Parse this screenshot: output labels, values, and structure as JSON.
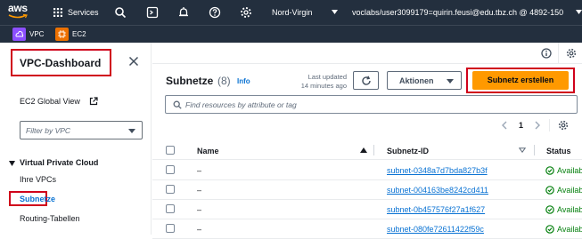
{
  "topbar": {
    "logo_text": "aws",
    "services_label": "Services",
    "region": "Nord-Virgin",
    "account": "voclabs/user3099179=quirin.feusi@edu.tbz.ch @ 4892-150"
  },
  "favorites": [
    {
      "label": "VPC",
      "color": "#8c4fff"
    },
    {
      "label": "EC2",
      "color": "#ed7100"
    }
  ],
  "sidebar": {
    "title": "VPC-Dashboard",
    "ec2_global_view": "EC2 Global View",
    "filter_placeholder": "Filter by VPC",
    "section": "Virtual Private Cloud",
    "items": [
      {
        "label": "Ihre VPCs"
      },
      {
        "label": "Subnetze"
      },
      {
        "label": "Routing-Tabellen"
      }
    ]
  },
  "main": {
    "title": "Subnetze",
    "count": "(8)",
    "info_label": "Info",
    "last_updated_line1": "Last updated",
    "last_updated_line2": "14 minutes ago",
    "actions_label": "Aktionen",
    "create_label": "Subnetz erstellen",
    "search_placeholder": "Find resources by attribute or tag",
    "page_number": "1",
    "columns": [
      "Name",
      "Subnetz-ID",
      "Status"
    ],
    "rows": [
      {
        "name": "–",
        "subnet_id": "subnet-0348a7d7bda827b3f",
        "status": "Available"
      },
      {
        "name": "–",
        "subnet_id": "subnet-004163be8242cd411",
        "status": "Available"
      },
      {
        "name": "–",
        "subnet_id": "subnet-0b457576f27a1f627",
        "status": "Available"
      },
      {
        "name": "–",
        "subnet_id": "subnet-080fe72611422f59c",
        "status": "Available"
      }
    ]
  },
  "colors": {
    "topbar": "#232f3e",
    "primary_button": "#ff9900",
    "link": "#0972d3",
    "success": "#037f0c",
    "highlight_box": "#d0021b"
  }
}
